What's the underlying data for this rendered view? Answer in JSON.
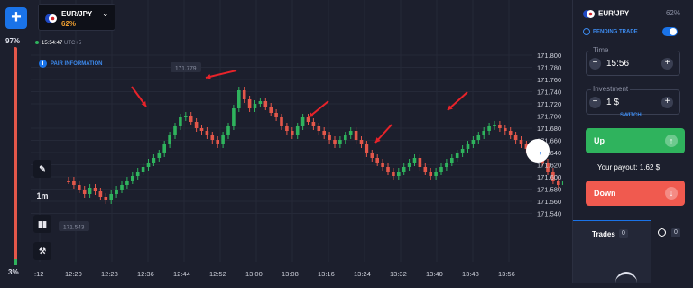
{
  "sentiment": {
    "top": "97%",
    "bottom": "3%",
    "buy_share": 0.03
  },
  "asset": {
    "name": "EUR/JPY",
    "payout_pct": "62%"
  },
  "clock": {
    "time": "15:54:47",
    "tz": "UTC+5"
  },
  "pair_info": "PAIR INFORMATION",
  "tools": {
    "timeframe": "1m"
  },
  "chart": {
    "price_labels": [
      "171.800",
      "171.780",
      "171.760",
      "171.740",
      "171.720",
      "171.700",
      "171.680",
      "171.660",
      "171.640",
      "171.620",
      "171.600",
      "171.580",
      "171.560",
      "171.540"
    ],
    "time_labels": [
      ":12",
      "12:20",
      "12:28",
      "12:36",
      "12:44",
      "12:52",
      "13:00",
      "13:08",
      "13:16",
      "13:24",
      "13:32",
      "13:40",
      "13:48",
      "13:56"
    ],
    "high_marker": "171.779",
    "low_marker": "171.543",
    "colors": {
      "up": "#2fb35d",
      "down": "#e4574a",
      "annotation": "#e8232a"
    }
  },
  "panel": {
    "asset": "EUR/JPY",
    "payout": "62%",
    "pending": "PENDING TRADE",
    "time_label": "Time",
    "time_value": "15:56",
    "investment_label": "Investment",
    "investment_value": "1 $",
    "switch": "SWITCH",
    "up": "Up",
    "down": "Down",
    "payout_text": "Your payout: 1.62 $",
    "trades": "Trades",
    "trades_count": "0",
    "timer_count": "0"
  }
}
